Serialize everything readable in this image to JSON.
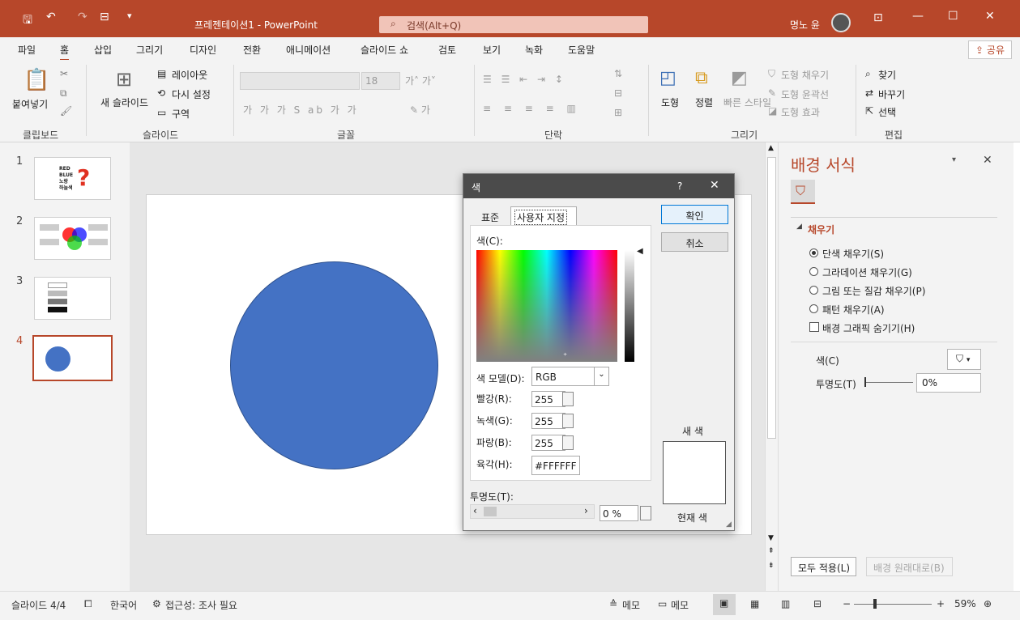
{
  "titlebar": {
    "doc_title": "프레젠테이션1 - PowerPoint",
    "search_placeholder": "검색(Alt+Q)",
    "user_name": "명노 윤"
  },
  "tabs": [
    "파일",
    "홈",
    "삽입",
    "그리기",
    "디자인",
    "전환",
    "애니메이션",
    "슬라이드 쇼",
    "검토",
    "보기",
    "녹화",
    "도움말"
  ],
  "share_label": "공유",
  "ribbon": {
    "paste": "붙여넣기",
    "new_slide": "새 슬라이드",
    "layout": "레이아웃",
    "reset": "다시 설정",
    "section": "구역",
    "font_size": "18",
    "shape": "도형",
    "arrange": "정렬",
    "quick_styles": "빠른 스타일",
    "shape_fill": "도형 채우기",
    "shape_outline": "도형 윤곽선",
    "shape_effects": "도형 효과",
    "find": "찾기",
    "replace": "바꾸기",
    "select": "선택",
    "groups": {
      "clipboard": "클립보드",
      "slides": "슬라이드",
      "font": "글꼴",
      "paragraph": "단락",
      "drawing": "그리기",
      "editing": "편집"
    }
  },
  "slides": [
    {
      "num": "1",
      "thumb_text": [
        "RED",
        "BLUE",
        "노랑",
        "하늘색"
      ]
    },
    {
      "num": "2"
    },
    {
      "num": "3"
    },
    {
      "num": "4"
    }
  ],
  "dialog": {
    "title": "색",
    "help": "?",
    "tab_standard": "표준",
    "tab_custom": "사용자 지정",
    "ok": "확인",
    "cancel": "취소",
    "colors_label": "색(C):",
    "color_model_label": "색 모델(D):",
    "color_model_value": "RGB",
    "red_label": "빨강(R):",
    "red_value": "255",
    "green_label": "녹색(G):",
    "green_value": "255",
    "blue_label": "파랑(B):",
    "blue_value": "255",
    "hex_label": "육각(H):",
    "hex_value": "#FFFFFF",
    "transparency_label": "투명도(T):",
    "transparency_value": "0 %",
    "new_label": "새 색",
    "current_label": "현재 색"
  },
  "format_pane": {
    "title": "배경 서식",
    "section_fill": "채우기",
    "options": [
      "단색 채우기(S)",
      "그라데이션 채우기(G)",
      "그림 또는 질감 채우기(P)",
      "패턴 채우기(A)"
    ],
    "hide_bg": "배경 그래픽 숨기기(H)",
    "color_label": "색(C)",
    "transparency_label": "투명도(T)",
    "transparency_value": "0%",
    "apply_all": "모두 적용(L)",
    "reset_bg": "배경 원래대로(B)"
  },
  "statusbar": {
    "slide_info": "슬라이드 4/4",
    "language": "한국어",
    "accessibility": "접근성: 조사 필요",
    "notes": "메모",
    "comments": "메모",
    "zoom": "59%"
  },
  "colors": {
    "accent": "#b7472a",
    "circle": "#4472c4"
  }
}
